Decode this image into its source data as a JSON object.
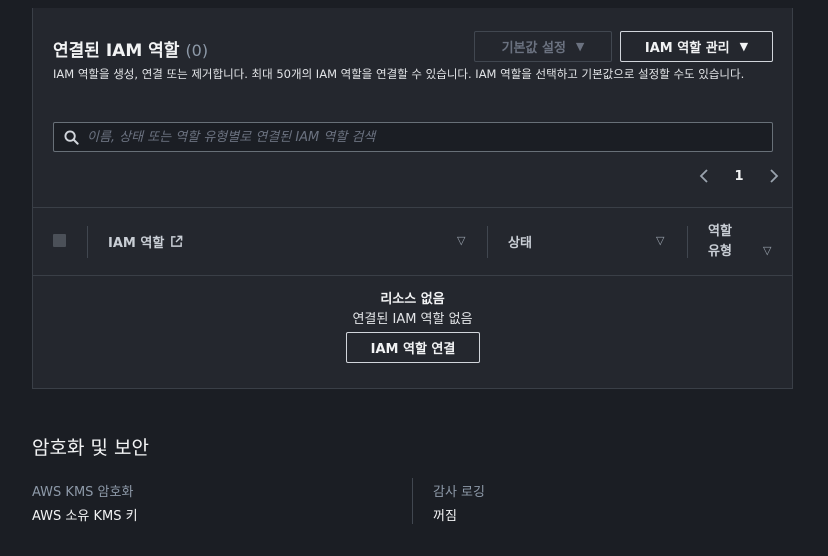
{
  "attached_roles": {
    "title": "연결된 IAM 역할",
    "count": "(0)",
    "description": "IAM 역할을 생성, 연결 또는 제거합니다. 최대 50개의 IAM 역할을 연결할 수 있습니다. IAM 역할을 선택하고 기본값으로 설정할 수도 있습니다.",
    "set_default_label": "기본값 설정",
    "manage_label": "IAM 역할 관리",
    "search_placeholder": "이름, 상태 또는 역할 유형별로 연결된 IAM 역할 검색",
    "page_number": "1",
    "columns": {
      "iam_role": "IAM 역할",
      "status": "상태",
      "role_type_line1": "역할",
      "role_type_line2": "유형"
    },
    "empty_title": "리소스 없음",
    "empty_subtitle": "연결된 IAM 역할 없음",
    "attach_label": "IAM 역할 연결"
  },
  "encryption": {
    "title": "암호화 및 보안",
    "kms_label": "AWS KMS 암호화",
    "kms_value": "AWS 소유 KMS 키",
    "audit_label": "감사 로깅",
    "audit_value": "꺼짐"
  }
}
